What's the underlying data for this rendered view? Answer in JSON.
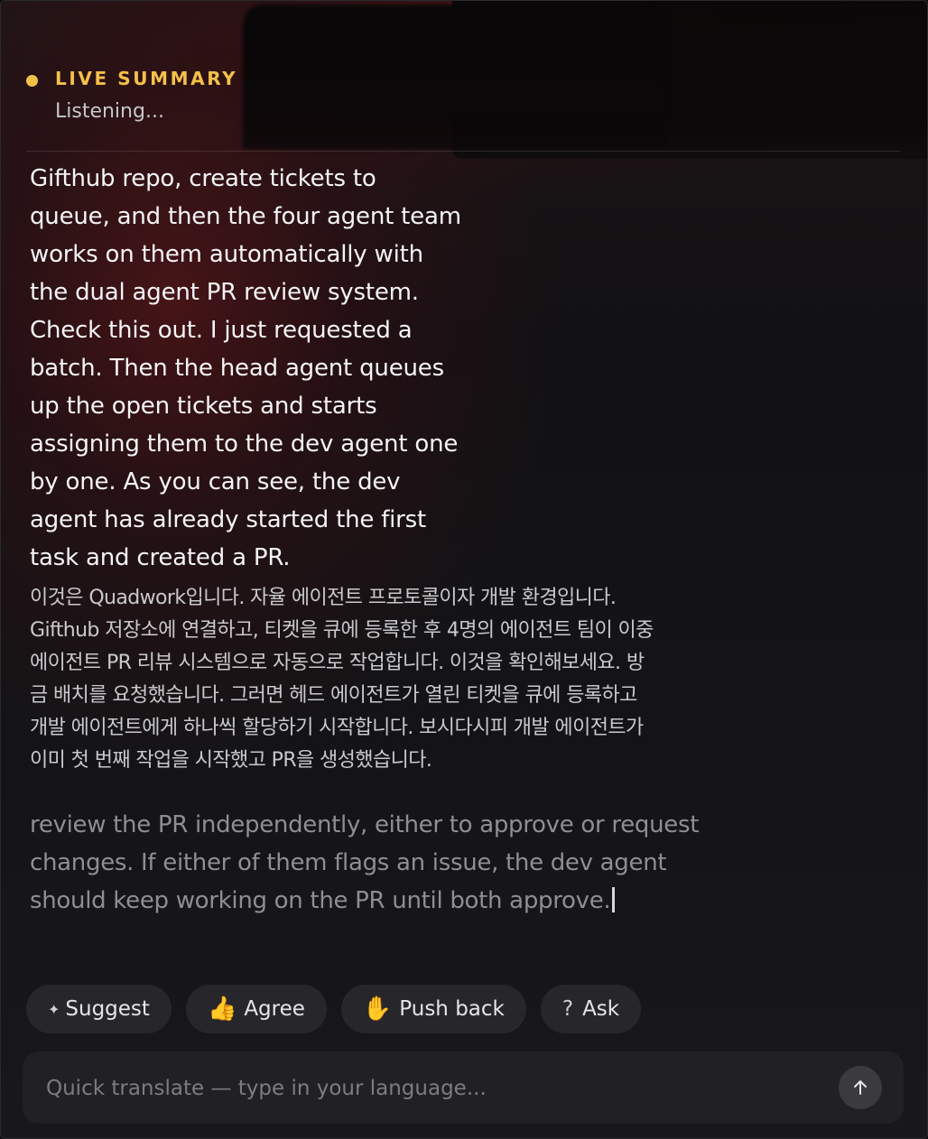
{
  "header": {
    "live_label": "LIVE SUMMARY",
    "status": "Listening..."
  },
  "transcript": {
    "english_lines": [
      "Gifthub repo, create tickets to",
      "queue, and then the four agent team",
      "works on them automatically with",
      "the dual agent PR review system.",
      "Check this out. I just requested a",
      "batch. Then the head agent queues",
      "up the open tickets and starts",
      "assigning them to the dev agent one",
      "by one. As you can see, the dev",
      "agent has already started the first",
      "task and created a PR."
    ],
    "korean_lines": [
      "이것은 Quadwork입니다. 자율 에이전트 프로토콜이자 개발 환경입니다.",
      "Gifthub 저장소에 연결하고, 티켓을 큐에 등록한 후 4명의 에이전트 팀이 이중",
      "에이전트 PR 리뷰 시스템으로 자동으로 작업합니다. 이것을 확인해보세요. 방",
      "금 배치를 요청했습니다. 그러면 헤드 에이전트가 열린 티켓을 큐에 등록하고",
      "개발 에이전트에게 하나씩 할당하기 시작합니다. 보시다시피 개발 에이전트가",
      "이미 첫 번째 작업을 시작했고 PR을 생성했습니다."
    ],
    "live_lines": [
      "review the PR independently, either to approve or request",
      "changes. If either of them flags an issue, the dev agent",
      "should keep working on the PR until both approve."
    ]
  },
  "actions": {
    "suggest": {
      "icon": "✦",
      "label": "Suggest"
    },
    "agree": {
      "icon": "👍",
      "label": "Agree"
    },
    "push_back": {
      "icon": "✋",
      "label": "Push back"
    },
    "ask": {
      "icon": "?",
      "label": "Ask"
    }
  },
  "input": {
    "placeholder": "Quick translate — type in your language...",
    "value": ""
  },
  "colors": {
    "accent": "#f3c14a",
    "chip_bg": "#27272b",
    "input_bg": "#212124"
  }
}
